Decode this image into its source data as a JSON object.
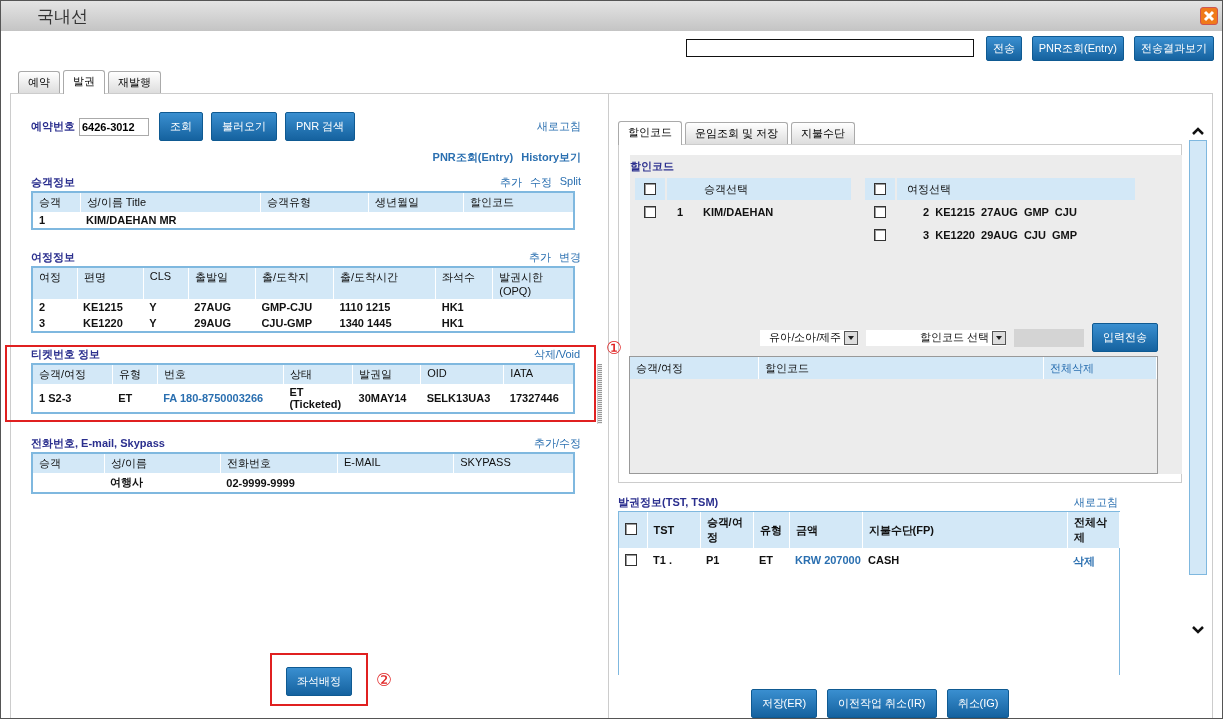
{
  "window": {
    "title": "국내선"
  },
  "top_bar": {
    "buttons": [
      "전송",
      "PNR조회(Entry)",
      "전송결과보기"
    ]
  },
  "main_tabs": [
    {
      "label": "예약",
      "selected": false
    },
    {
      "label": "발권",
      "selected": true
    },
    {
      "label": "재발행",
      "selected": false
    }
  ],
  "left": {
    "booking": {
      "label": "예약번호",
      "value": "6426-3012",
      "buttons": [
        "조회",
        "불러오기",
        "PNR 검색"
      ],
      "refresh_link": "새로고침"
    },
    "links": [
      "PNR조회(Entry)",
      "History보기"
    ],
    "sections": [
      {
        "title": "승객정보",
        "actions": [
          "추가",
          "수정",
          "Split"
        ],
        "table": {
          "columns": [
            "승객",
            "성/이름 Title",
            "승객유형",
            "생년월일",
            "할인코드"
          ],
          "rows": [
            [
              "1",
              "KIM/DAEHAN  MR",
              "",
              "",
              ""
            ]
          ]
        }
      },
      {
        "title": "여정정보",
        "actions": [
          "추가",
          "변경"
        ],
        "table": {
          "columns": [
            "여정",
            "편명",
            "CLS",
            "출발일",
            "출/도착지",
            "출/도착시간",
            "좌석수",
            "발권시한 (OPQ)"
          ],
          "rows": [
            [
              "2",
              "KE1215",
              "Y",
              "27AUG",
              "GMP-CJU",
              "1110 1215",
              "HK1",
              ""
            ],
            [
              "3",
              "KE1220",
              "Y",
              "29AUG",
              "CJU-GMP",
              "1340 1445",
              "HK1",
              ""
            ]
          ]
        }
      },
      {
        "title": "티켓번호 정보",
        "actions": [
          "삭제/Void"
        ],
        "callout": "①",
        "table": {
          "columns": [
            "승객/여정",
            "유형",
            "번호",
            "상태",
            "발권일",
            "OID",
            "IATA"
          ],
          "rows": [
            [
              "1 S2-3",
              "ET",
              {
                "text": "FA 180-8750003266",
                "kind": "link"
              },
              "ET (Ticketed)",
              "30MAY14",
              "SELK13UA3",
              "17327446"
            ]
          ]
        }
      },
      {
        "title": "전화번호, E-mail, Skypass",
        "actions": [
          "추가/수정"
        ],
        "table": {
          "columns": [
            "승객",
            "성/이름",
            "전화번호",
            "E-MAIL",
            "SKYPASS"
          ],
          "rows": [
            [
              "",
              "여행사",
              "02-9999-9999",
              "",
              ""
            ]
          ]
        }
      }
    ],
    "seat_button": {
      "label": "좌석배정",
      "callout": "②"
    }
  },
  "right": {
    "tabs": [
      {
        "label": "할인코드",
        "selected": true
      },
      {
        "label": "운임조회 및 저장",
        "selected": false
      },
      {
        "label": "지불수단",
        "selected": false
      }
    ],
    "discount": {
      "title": "할인코드",
      "passenger_header": "승객선택",
      "passenger_all_checked": false,
      "passengers": [
        {
          "number": "1",
          "name": "KIM/DAEHAN",
          "checked": false
        }
      ],
      "segment_header": "여정선택",
      "segment_all_checked": false,
      "segments": [
        {
          "text": "2  KE1215  27AUG  GMP  CJU",
          "checked": false
        },
        {
          "text": "3  KE1220  29AUG  CJU  GMP",
          "checked": false
        }
      ],
      "selects": [
        {
          "value": "유아/소아/제주"
        },
        {
          "value": "할인코드 선택"
        }
      ],
      "send_button": "입력전송",
      "table_columns": [
        "승객/여정",
        "할인코드",
        {
          "text": "전체삭제",
          "kind": "link"
        }
      ]
    },
    "issuance": {
      "title": "발권정보(TST, TSM)",
      "refresh_link": "새로고침",
      "all_checked": false,
      "columns": [
        "TST",
        "승객/여정",
        "유형",
        "금액",
        "지불수단(FP)",
        "전체삭제"
      ],
      "rows": [
        {
          "checked": false,
          "cells": [
            "T1 .",
            "P1",
            "ET",
            {
              "text": "KRW 207000",
              "kind": "link"
            },
            "CASH",
            {
              "text": "삭제",
              "kind": "link"
            }
          ]
        }
      ]
    },
    "buttons": [
      "저장(ER)",
      "이전작업 취소(IR)",
      "취소(IG)"
    ]
  }
}
